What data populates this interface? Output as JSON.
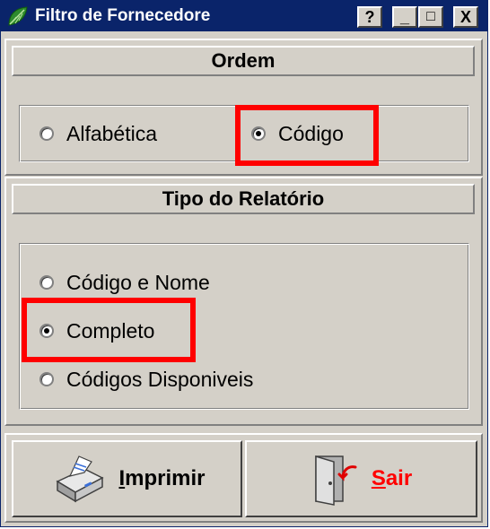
{
  "window": {
    "title": "Filtro de Fornecedore",
    "help_button": "?",
    "minimize_button": "_",
    "maximize_button": "□",
    "close_button": "X"
  },
  "ordem": {
    "header": "Ordem",
    "options": [
      {
        "label": "Alfabética",
        "checked": false
      },
      {
        "label": "Código",
        "checked": true
      }
    ]
  },
  "tipo_relatorio": {
    "header": "Tipo do Relatório",
    "options": [
      {
        "label": "Código e Nome",
        "checked": false
      },
      {
        "label": "Completo",
        "checked": true
      },
      {
        "label": "Códigos Disponiveis",
        "checked": false
      }
    ]
  },
  "buttons": {
    "imprimir": {
      "mnemonic": "I",
      "rest": "mprimir",
      "color": "#000000"
    },
    "sair": {
      "mnemonic": "S",
      "rest": "air",
      "color": "#ff0000"
    }
  },
  "colors": {
    "titlebar": "#0a246a",
    "face": "#d4d0c8",
    "highlight": "#ff0000"
  }
}
